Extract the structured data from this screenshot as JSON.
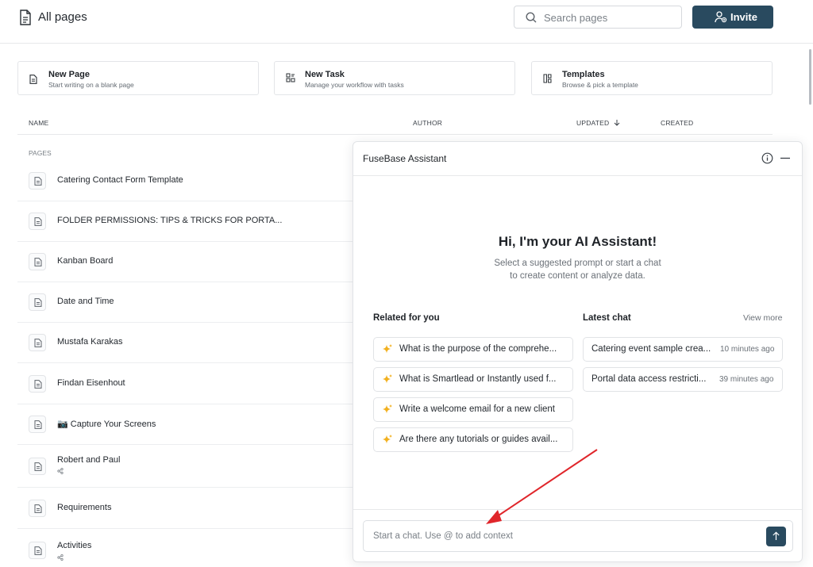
{
  "header": {
    "title": "All pages",
    "search_placeholder": "Search pages",
    "invite_label": "Invite"
  },
  "quick_actions": [
    {
      "title": "New Page",
      "subtitle": "Start writing on a blank page",
      "icon": "document-icon"
    },
    {
      "title": "New Task",
      "subtitle": "Manage your workflow with tasks",
      "icon": "task-grid-icon"
    },
    {
      "title": "Templates",
      "subtitle": "Browse & pick a template",
      "icon": "template-icon"
    }
  ],
  "table": {
    "columns": {
      "name": "NAME",
      "author": "AUTHOR",
      "updated": "UPDATED",
      "created": "CREATED"
    },
    "section_label": "PAGES",
    "rows": [
      {
        "name": "Catering Contact Form Template",
        "sub": ""
      },
      {
        "name": "FOLDER PERMISSIONS: TIPS & TRICKS FOR PORTA...",
        "sub": ""
      },
      {
        "name": "Kanban Board",
        "sub": ""
      },
      {
        "name": "Date and Time",
        "sub": ""
      },
      {
        "name": "Mustafa Karakas",
        "sub": ""
      },
      {
        "name": "Findan Eisenhout",
        "sub": ""
      },
      {
        "name": "📷 Capture Your Screens",
        "sub": ""
      },
      {
        "name": "Robert and Paul",
        "sub": "share"
      },
      {
        "name": "Requirements",
        "sub": ""
      },
      {
        "name": "Activities",
        "sub": "share"
      }
    ]
  },
  "assistant": {
    "title": "FuseBase Assistant",
    "greeting": "Hi, I'm your AI Assistant!",
    "subtitle_line1": "Select a suggested prompt or start a chat",
    "subtitle_line2": "to create content or analyze data.",
    "related_heading": "Related for you",
    "latest_heading": "Latest chat",
    "view_more": "View more",
    "prompts": [
      "What is the purpose of the comprehe...",
      "What is Smartlead or Instantly used f...",
      "Write a welcome email for a new client",
      "Are there any tutorials or guides avail..."
    ],
    "chats": [
      {
        "title": "Catering event sample crea...",
        "time": "10 minutes ago"
      },
      {
        "title": "Portal data access restricti...",
        "time": "39 minutes ago"
      }
    ],
    "input_placeholder": "Start a chat. Use @ to add context"
  },
  "colors": {
    "accent": "#294a5f",
    "sparkle": "#f2b01e",
    "annotation_arrow": "#e0262b"
  }
}
